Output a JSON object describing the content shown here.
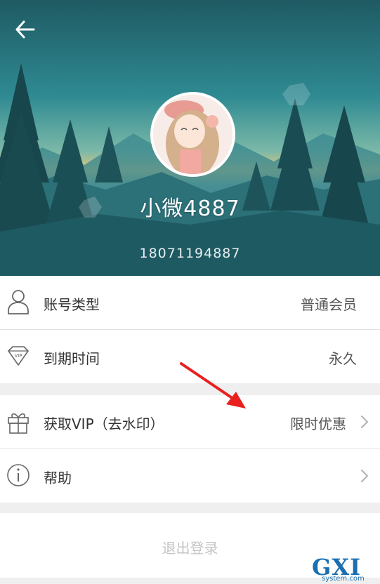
{
  "profile": {
    "nickname": "小微4887",
    "phone": "18071194887"
  },
  "rows": {
    "account_type": {
      "label": "账号类型",
      "value": "普通会员"
    },
    "expiry": {
      "label": "到期时间",
      "value": "永久"
    },
    "vip": {
      "label": "获取VIP（去水印）",
      "value": "限时优惠"
    },
    "help": {
      "label": "帮助"
    }
  },
  "logout": {
    "label": "退出登录"
  },
  "watermark": {
    "text": "GXI网",
    "sub": "system.com"
  },
  "icons": {
    "back": "back-arrow-icon",
    "account": "user-icon",
    "expiry": "vip-diamond-icon",
    "vip": "gift-icon",
    "help": "info-icon",
    "chevron": "chevron-right-icon"
  },
  "colors": {
    "arrow_annotation": "#e8211f",
    "logout_text": "#c4c4c4",
    "watermark": "#1b6fb0"
  }
}
